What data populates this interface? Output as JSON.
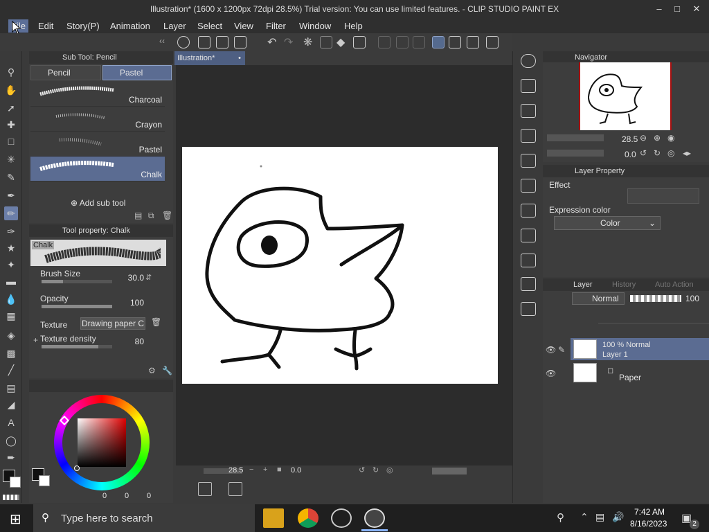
{
  "window": {
    "title": "Illustration* (1600 x 1200px 72dpi 28.5%)  Trial version: You can use limited features. - CLIP STUDIO PAINT EX"
  },
  "menu": [
    "File",
    "Edit",
    "Story(P)",
    "Animation",
    "Layer",
    "Select",
    "View",
    "Filter",
    "Window",
    "Help"
  ],
  "subtool": {
    "header": "Sub Tool: Pencil",
    "tabs": [
      "Pencil",
      "Pastel"
    ],
    "brushes": [
      "Charcoal",
      "Crayon",
      "Pastel",
      "Chalk"
    ],
    "selected_brush": "Chalk",
    "add_label": "Add sub tool"
  },
  "toolprop": {
    "header": "Tool property: Chalk",
    "preview_label": "Chalk",
    "brush_size_label": "Brush Size",
    "brush_size_value": "30.0",
    "opacity_label": "Opacity",
    "opacity_value": "100",
    "texture_label": "Texture",
    "texture_value": "Drawing paper C",
    "texture_density_label": "Texture density",
    "texture_density_value": "80"
  },
  "color": {
    "current": "#111111",
    "secondary": "#ffffff",
    "values": [
      "0",
      "0",
      "0"
    ]
  },
  "canvas": {
    "tab_label": "Illustration*",
    "zoom": "28.5",
    "angle": "0.0"
  },
  "navigator": {
    "header": "Navigator",
    "zoom": "28.5",
    "angle": "0.0"
  },
  "layer_property": {
    "header": "Layer Property",
    "effect_label": "Effect",
    "expression_label": "Expression color",
    "expression_value": "Color"
  },
  "layer_panel": {
    "tabs": [
      "Layer",
      "History",
      "Auto Action"
    ],
    "blend_mode": "Normal",
    "opacity": "100",
    "layers": [
      {
        "info": "100 % Normal",
        "name": "Layer 1"
      },
      {
        "info": "",
        "name": "Paper"
      }
    ]
  },
  "taskbar": {
    "search_placeholder": "Type here to search",
    "time": "7:42 AM",
    "date": "8/16/2023",
    "notification_count": "2"
  }
}
